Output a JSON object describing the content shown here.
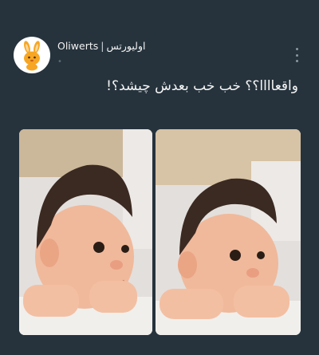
{
  "post": {
    "author_name": "اولیورتس",
    "author_separator": "|",
    "author_handle": "Oliwerts",
    "caption": "واقعاااا؟؟ خب خب بعدش چیشد؟!"
  },
  "icons": {
    "avatar": "rabbit-avatar-icon",
    "more": "more-vertical-icon"
  },
  "colors": {
    "background": "#26333d",
    "text": "#f5f5f5"
  }
}
